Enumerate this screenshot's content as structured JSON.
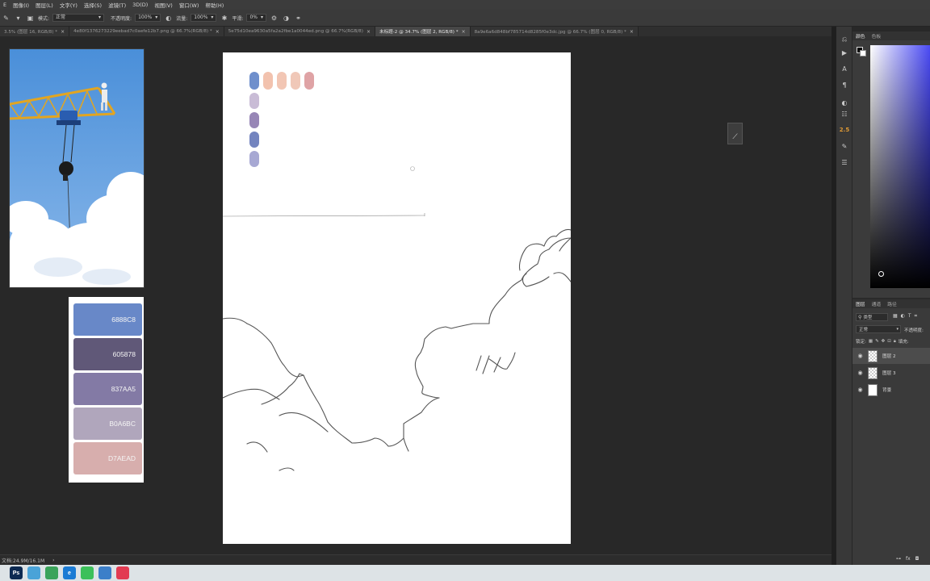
{
  "menubar": {
    "items": [
      "E",
      "图像(I)",
      "图层(L)",
      "文字(Y)",
      "选择(S)",
      "滤镜(T)",
      "3D(D)",
      "视图(V)",
      "窗口(W)",
      "帮助(H)"
    ]
  },
  "options": {
    "mode_label": "模式:",
    "mode_value": "正常",
    "opacity_label": "不透明度:",
    "opacity_value": "100%",
    "flow_label": "流量:",
    "flow_value": "100%",
    "smoothing_label": "平滑:",
    "smoothing_value": "0%"
  },
  "tabs": [
    {
      "label": "3.5% (图层 16, RGB/8) *",
      "active": false
    },
    {
      "label": "4e80f1376273229eebad7c0aefe12b7.png @ 66.7%(RGB/8) *",
      "active": false
    },
    {
      "label": "5e75d10ea9630a5fa2a2fbe1a0044ed.png @ 66.7%(RGB/8)",
      "active": false
    },
    {
      "label": "未标题-2 @ 34.7% (图层 2, RGB/8) *",
      "active": true
    },
    {
      "label": "8a9e6a6d848bf785714d8285f0e3dc.jpg @ 66.7% (图层 0, RGB/8) *",
      "active": false
    }
  ],
  "swatches": [
    {
      "hex": "6888C8",
      "color": "#6888c8"
    },
    {
      "hex": "605878",
      "color": "#605878"
    },
    {
      "hex": "837AA5",
      "color": "#837aa5"
    },
    {
      "hex": "B0A6BC",
      "color": "#b0a6bc"
    },
    {
      "hex": "D7AEAD",
      "color": "#d7aead"
    }
  ],
  "canvas_palette": {
    "row_colors": [
      "#6f8fcc",
      "#f2c2ae",
      "#f2c6b4",
      "#f0c8b8",
      "#dfa3a5"
    ],
    "column_colors": [
      "#c9bcd6",
      "#9786b6",
      "#7384bf",
      "#a7a8d3"
    ]
  },
  "status": {
    "doc_size": "文档:24.9M/16.1M"
  },
  "right_panels": {
    "color_tabs": [
      "颜色",
      "色板"
    ],
    "layer_tabs": [
      "图层",
      "通道",
      "路径"
    ],
    "kind_filter": "类型",
    "blend_mode": "正常",
    "opacity_label": "不透明度:",
    "lock_label": "锁定:",
    "fill_label": "填充:",
    "tool_value": "2.5"
  },
  "layers": [
    {
      "name": "图层 2",
      "active": true,
      "type": "transparent"
    },
    {
      "name": "图层 3",
      "active": false,
      "type": "transparent"
    },
    {
      "name": "背景",
      "active": false,
      "type": "solid"
    }
  ],
  "taskbar": {
    "apps": [
      {
        "name": "photoshop",
        "label": "Ps",
        "color": "#0d2a52"
      },
      {
        "name": "app-2",
        "label": "",
        "color": "#4aa3d8"
      },
      {
        "name": "app-3",
        "label": "",
        "color": "#3aa35a"
      },
      {
        "name": "edge",
        "label": "e",
        "color": "#1b7bd4"
      },
      {
        "name": "wechat",
        "label": "",
        "color": "#3cc05a"
      },
      {
        "name": "app-6",
        "label": "",
        "color": "#3c7fc9"
      },
      {
        "name": "app-7",
        "label": "",
        "color": "#e23b52"
      }
    ]
  }
}
